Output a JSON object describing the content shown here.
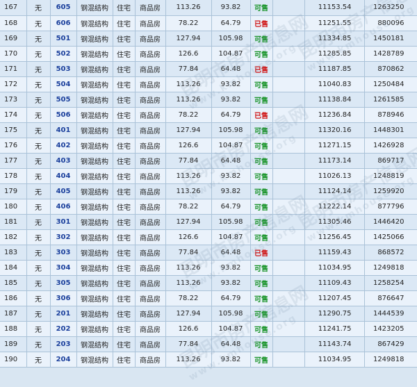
{
  "colors": {
    "available": "#159225",
    "sold": "#d01414",
    "room_number": "#1a3f9c"
  },
  "rows": [
    {
      "no": "167",
      "floor_mark": "无",
      "room": "605",
      "structure": "钢混结构",
      "use": "住宅",
      "type": "商品房",
      "area": "113.26",
      "inner_area": "93.82",
      "status": "可售",
      "unit_price": "11153.54",
      "total": "1263250"
    },
    {
      "no": "168",
      "floor_mark": "无",
      "room": "606",
      "structure": "钢混结构",
      "use": "住宅",
      "type": "商品房",
      "area": "78.22",
      "inner_area": "64.79",
      "status": "已售",
      "unit_price": "11251.55",
      "total": "880096"
    },
    {
      "no": "169",
      "floor_mark": "无",
      "room": "501",
      "structure": "钢混结构",
      "use": "住宅",
      "type": "商品房",
      "area": "127.94",
      "inner_area": "105.98",
      "status": "可售",
      "unit_price": "11334.85",
      "total": "1450181"
    },
    {
      "no": "170",
      "floor_mark": "无",
      "room": "502",
      "structure": "钢混结构",
      "use": "住宅",
      "type": "商品房",
      "area": "126.6",
      "inner_area": "104.87",
      "status": "可售",
      "unit_price": "11285.85",
      "total": "1428789"
    },
    {
      "no": "171",
      "floor_mark": "无",
      "room": "503",
      "structure": "钢混结构",
      "use": "住宅",
      "type": "商品房",
      "area": "77.84",
      "inner_area": "64.48",
      "status": "已售",
      "unit_price": "11187.85",
      "total": "870862"
    },
    {
      "no": "172",
      "floor_mark": "无",
      "room": "504",
      "structure": "钢混结构",
      "use": "住宅",
      "type": "商品房",
      "area": "113.26",
      "inner_area": "93.82",
      "status": "可售",
      "unit_price": "11040.83",
      "total": "1250484"
    },
    {
      "no": "173",
      "floor_mark": "无",
      "room": "505",
      "structure": "钢混结构",
      "use": "住宅",
      "type": "商品房",
      "area": "113.26",
      "inner_area": "93.82",
      "status": "可售",
      "unit_price": "11138.84",
      "total": "1261585"
    },
    {
      "no": "174",
      "floor_mark": "无",
      "room": "506",
      "structure": "钢混结构",
      "use": "住宅",
      "type": "商品房",
      "area": "78.22",
      "inner_area": "64.79",
      "status": "已售",
      "unit_price": "11236.84",
      "total": "878946"
    },
    {
      "no": "175",
      "floor_mark": "无",
      "room": "401",
      "structure": "钢混结构",
      "use": "住宅",
      "type": "商品房",
      "area": "127.94",
      "inner_area": "105.98",
      "status": "可售",
      "unit_price": "11320.16",
      "total": "1448301"
    },
    {
      "no": "176",
      "floor_mark": "无",
      "room": "402",
      "structure": "钢混结构",
      "use": "住宅",
      "type": "商品房",
      "area": "126.6",
      "inner_area": "104.87",
      "status": "可售",
      "unit_price": "11271.15",
      "total": "1426928"
    },
    {
      "no": "177",
      "floor_mark": "无",
      "room": "403",
      "structure": "钢混结构",
      "use": "住宅",
      "type": "商品房",
      "area": "77.84",
      "inner_area": "64.48",
      "status": "可售",
      "unit_price": "11173.14",
      "total": "869717"
    },
    {
      "no": "178",
      "floor_mark": "无",
      "room": "404",
      "structure": "钢混结构",
      "use": "住宅",
      "type": "商品房",
      "area": "113.26",
      "inner_area": "93.82",
      "status": "可售",
      "unit_price": "11026.13",
      "total": "1248819"
    },
    {
      "no": "179",
      "floor_mark": "无",
      "room": "405",
      "structure": "钢混结构",
      "use": "住宅",
      "type": "商品房",
      "area": "113.26",
      "inner_area": "93.82",
      "status": "可售",
      "unit_price": "11124.14",
      "total": "1259920"
    },
    {
      "no": "180",
      "floor_mark": "无",
      "room": "406",
      "structure": "钢混结构",
      "use": "住宅",
      "type": "商品房",
      "area": "78.22",
      "inner_area": "64.79",
      "status": "可售",
      "unit_price": "11222.14",
      "total": "877796"
    },
    {
      "no": "181",
      "floor_mark": "无",
      "room": "301",
      "structure": "钢混结构",
      "use": "住宅",
      "type": "商品房",
      "area": "127.94",
      "inner_area": "105.98",
      "status": "可售",
      "unit_price": "11305.46",
      "total": "1446420"
    },
    {
      "no": "182",
      "floor_mark": "无",
      "room": "302",
      "structure": "钢混结构",
      "use": "住宅",
      "type": "商品房",
      "area": "126.6",
      "inner_area": "104.87",
      "status": "可售",
      "unit_price": "11256.45",
      "total": "1425066"
    },
    {
      "no": "183",
      "floor_mark": "无",
      "room": "303",
      "structure": "钢混结构",
      "use": "住宅",
      "type": "商品房",
      "area": "77.84",
      "inner_area": "64.48",
      "status": "已售",
      "unit_price": "11159.43",
      "total": "868572"
    },
    {
      "no": "184",
      "floor_mark": "无",
      "room": "304",
      "structure": "钢混结构",
      "use": "住宅",
      "type": "商品房",
      "area": "113.26",
      "inner_area": "93.82",
      "status": "可售",
      "unit_price": "11034.95",
      "total": "1249818"
    },
    {
      "no": "185",
      "floor_mark": "无",
      "room": "305",
      "structure": "钢混结构",
      "use": "住宅",
      "type": "商品房",
      "area": "113.26",
      "inner_area": "93.82",
      "status": "可售",
      "unit_price": "11109.43",
      "total": "1258254"
    },
    {
      "no": "186",
      "floor_mark": "无",
      "room": "306",
      "structure": "钢混结构",
      "use": "住宅",
      "type": "商品房",
      "area": "78.22",
      "inner_area": "64.79",
      "status": "可售",
      "unit_price": "11207.45",
      "total": "876647"
    },
    {
      "no": "187",
      "floor_mark": "无",
      "room": "201",
      "structure": "钢混结构",
      "use": "住宅",
      "type": "商品房",
      "area": "127.94",
      "inner_area": "105.98",
      "status": "可售",
      "unit_price": "11290.75",
      "total": "1444539"
    },
    {
      "no": "188",
      "floor_mark": "无",
      "room": "202",
      "structure": "钢混结构",
      "use": "住宅",
      "type": "商品房",
      "area": "126.6",
      "inner_area": "104.87",
      "status": "可售",
      "unit_price": "11241.75",
      "total": "1423205"
    },
    {
      "no": "189",
      "floor_mark": "无",
      "room": "203",
      "structure": "钢混结构",
      "use": "住宅",
      "type": "商品房",
      "area": "77.84",
      "inner_area": "64.48",
      "status": "可售",
      "unit_price": "11143.74",
      "total": "867429"
    },
    {
      "no": "190",
      "floor_mark": "无",
      "room": "204",
      "structure": "钢混结构",
      "use": "住宅",
      "type": "商品房",
      "area": "113.26",
      "inner_area": "93.82",
      "status": "可售",
      "unit_price": "11034.95",
      "total": "1249818"
    }
  ],
  "watermark": {
    "text": "昆明市房产信息网",
    "url": "www.kmhouse.org"
  }
}
